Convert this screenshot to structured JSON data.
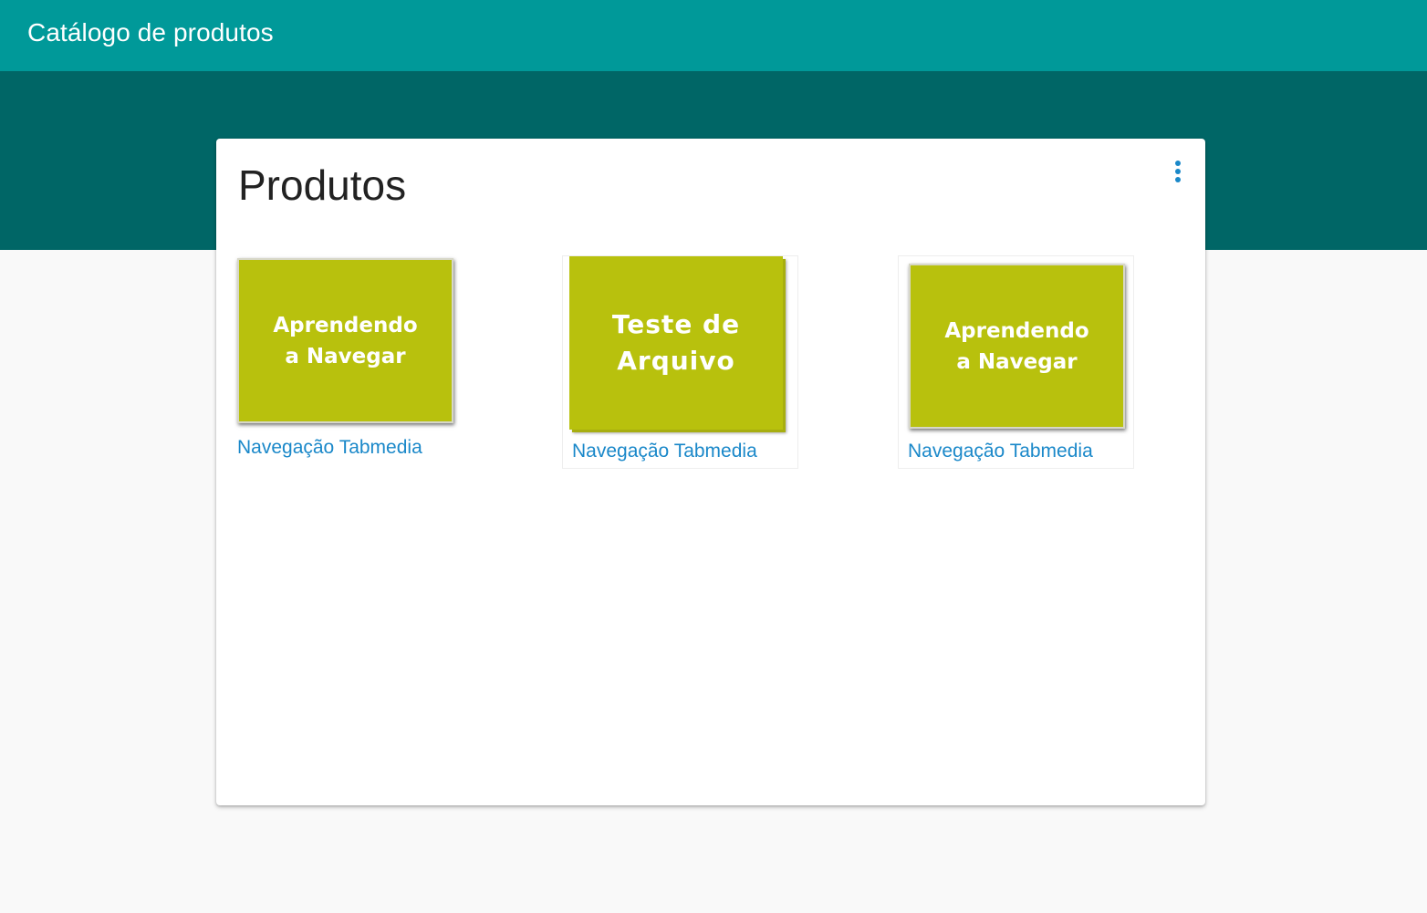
{
  "header": {
    "title": "Catálogo de produtos"
  },
  "card": {
    "title": "Produtos",
    "menu_icon": "more-vertical-icon"
  },
  "products": [
    {
      "thumbnail_text": "Aprendendo\na Navegar",
      "link": "Navegação Tabmedia"
    },
    {
      "thumbnail_text": "Teste de\nArquivo",
      "link": "Navegação Tabmedia"
    },
    {
      "thumbnail_text": "Aprendendo\na Navegar",
      "link": "Navegação Tabmedia"
    }
  ],
  "colors": {
    "topbar": "#009999",
    "band": "#006666",
    "thumbnail": "#b8c10d",
    "link": "#1a88c9",
    "menu_icon": "#1a88c9"
  }
}
